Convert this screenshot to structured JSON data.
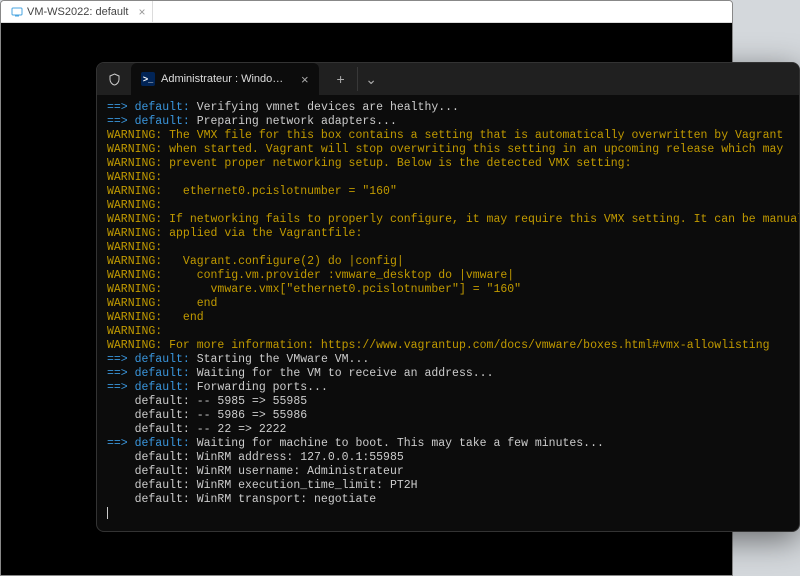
{
  "bg": {
    "tab_label": "VM-WS2022: default"
  },
  "term": {
    "tab_title": "Administrateur : Windows Pov",
    "new_tab": "+",
    "dropdown": "⌄"
  },
  "lines": [
    {
      "kind": "cyan",
      "prefix": "==> default: ",
      "rest": "Verifying vmnet devices are healthy..."
    },
    {
      "kind": "cyan",
      "prefix": "==> default: ",
      "rest": "Preparing network adapters..."
    },
    {
      "kind": "warn",
      "rest": "WARNING: The VMX file for this box contains a setting that is automatically overwritten by Vagrant"
    },
    {
      "kind": "warn",
      "rest": "WARNING: when started. Vagrant will stop overwriting this setting in an upcoming release which may"
    },
    {
      "kind": "warn",
      "rest": "WARNING: prevent proper networking setup. Below is the detected VMX setting:"
    },
    {
      "kind": "warn",
      "rest": "WARNING:"
    },
    {
      "kind": "warn",
      "rest": "WARNING:   ethernet0.pcislotnumber = \"160\""
    },
    {
      "kind": "warn",
      "rest": "WARNING:"
    },
    {
      "kind": "warn",
      "rest": "WARNING: If networking fails to properly configure, it may require this VMX setting. It can be manually"
    },
    {
      "kind": "warn",
      "rest": "WARNING: applied via the Vagrantfile:"
    },
    {
      "kind": "warn",
      "rest": "WARNING:"
    },
    {
      "kind": "warn",
      "rest": "WARNING:   Vagrant.configure(2) do |config|"
    },
    {
      "kind": "warn",
      "rest": "WARNING:     config.vm.provider :vmware_desktop do |vmware|"
    },
    {
      "kind": "warn",
      "rest": "WARNING:       vmware.vmx[\"ethernet0.pcislotnumber\"] = \"160\""
    },
    {
      "kind": "warn",
      "rest": "WARNING:     end"
    },
    {
      "kind": "warn",
      "rest": "WARNING:   end"
    },
    {
      "kind": "warn",
      "rest": "WARNING:"
    },
    {
      "kind": "warn",
      "rest": "WARNING: For more information: https://www.vagrantup.com/docs/vmware/boxes.html#vmx-allowlisting"
    },
    {
      "kind": "cyan",
      "prefix": "==> default: ",
      "rest": "Starting the VMware VM..."
    },
    {
      "kind": "cyan",
      "prefix": "==> default: ",
      "rest": "Waiting for the VM to receive an address..."
    },
    {
      "kind": "cyan",
      "prefix": "==> default: ",
      "rest": "Forwarding ports..."
    },
    {
      "kind": "plain",
      "rest": "    default: -- 5985 => 55985"
    },
    {
      "kind": "plain",
      "rest": "    default: -- 5986 => 55986"
    },
    {
      "kind": "plain",
      "rest": "    default: -- 22 => 2222"
    },
    {
      "kind": "cyan",
      "prefix": "==> default: ",
      "rest": "Waiting for machine to boot. This may take a few minutes..."
    },
    {
      "kind": "plain",
      "rest": "    default: WinRM address: 127.0.0.1:55985"
    },
    {
      "kind": "plain",
      "rest": "    default: WinRM username: Administrateur"
    },
    {
      "kind": "plain",
      "rest": "    default: WinRM execution_time_limit: PT2H"
    },
    {
      "kind": "plain",
      "rest": "    default: WinRM transport: negotiate"
    }
  ]
}
